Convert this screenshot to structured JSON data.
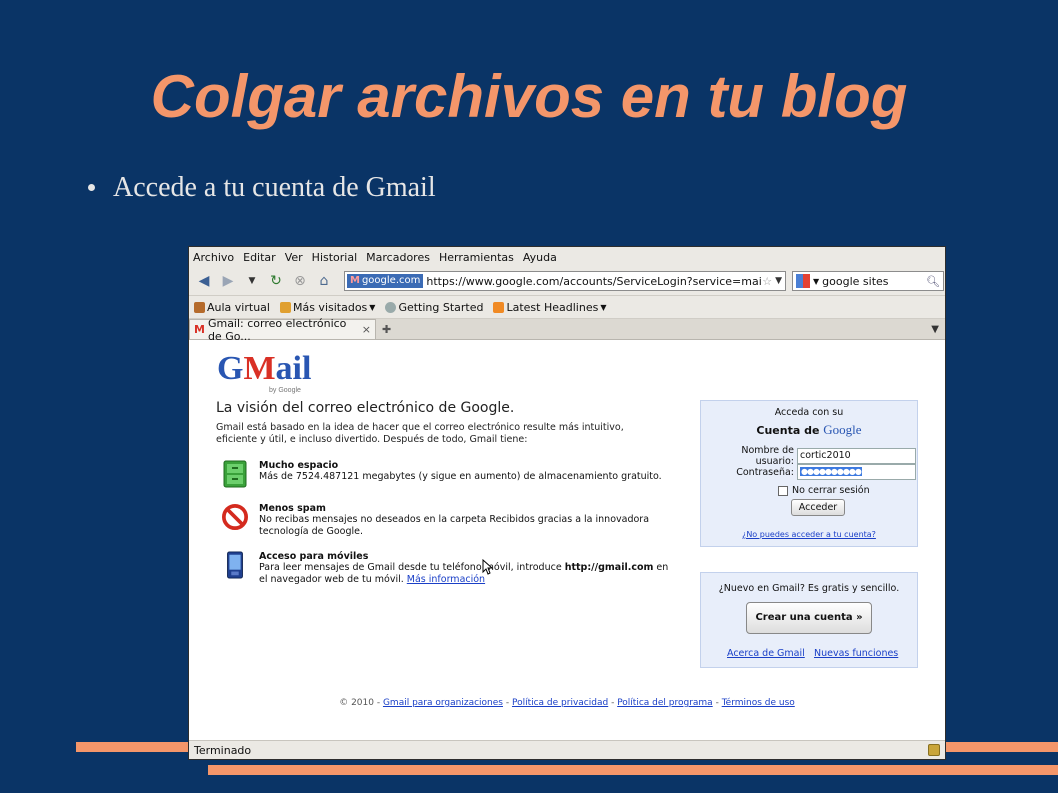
{
  "slide": {
    "title": "Colgar archivos en tu blog",
    "bullet": "Accede a tu cuenta de Gmail"
  },
  "browser": {
    "menu": [
      "Archivo",
      "Editar",
      "Ver",
      "Historial",
      "Marcadores",
      "Herramientas",
      "Ayuda"
    ],
    "url_site": "google.com",
    "url": "https://www.google.com/accounts/ServiceLogin?service=mail&passi",
    "search_value": "google sites",
    "bookmarks": [
      "Aula virtual",
      "Más visitados",
      "Getting Started",
      "Latest Headlines"
    ],
    "tab_title": "Gmail: correo electrónico de Go...",
    "status": "Terminado"
  },
  "page": {
    "logo": "Gmail",
    "logo_sub": "by Google",
    "headline": "La visión del correo electrónico de Google.",
    "intro": "Gmail está basado en la idea de hacer que el correo electrónico resulte más intuitivo, eficiente y útil, e incluso divertido. Después de todo, Gmail tiene:",
    "features": [
      {
        "title": "Mucho espacio",
        "desc": "Más de 7524.487121 megabytes (y sigue en aumento) de almacenamiento gratuito."
      },
      {
        "title": "Menos spam",
        "desc": "No recibas mensajes no deseados en la carpeta Recibidos gracias a la innovadora tecnología de Google."
      },
      {
        "title": "Acceso para móviles",
        "desc_pre": "Para leer mensajes de Gmail desde tu teléfono móvil, introduce ",
        "desc_bold": "http://gmail.com",
        "desc_post": " en el navegador web de tu móvil. ",
        "link": "Más información"
      }
    ],
    "login": {
      "header1": "Acceda con su",
      "header2": "Cuenta de",
      "header_brand": "Google",
      "user_label": "Nombre de usuario:",
      "user_value": "cortic2010",
      "pass_label": "Contraseña:",
      "pass_mask": "●●●●●●●●●●",
      "remember": "No cerrar sesión",
      "submit": "Acceder",
      "forgot": "¿No puedes acceder a tu cuenta?"
    },
    "signup": {
      "text": "¿Nuevo en Gmail? Es gratis y sencillo.",
      "button": "Crear una cuenta »",
      "link1": "Acerca de Gmail",
      "link2": "Nuevas funciones"
    },
    "footer": {
      "copyright": "© 2010 -",
      "links": [
        "Gmail para organizaciones",
        "Política de privacidad",
        "Política del programa",
        "Términos de uso"
      ]
    }
  },
  "colors": {
    "slide_bg": "#0a3466",
    "accent": "#f4966a",
    "link": "#1a3fc7"
  }
}
